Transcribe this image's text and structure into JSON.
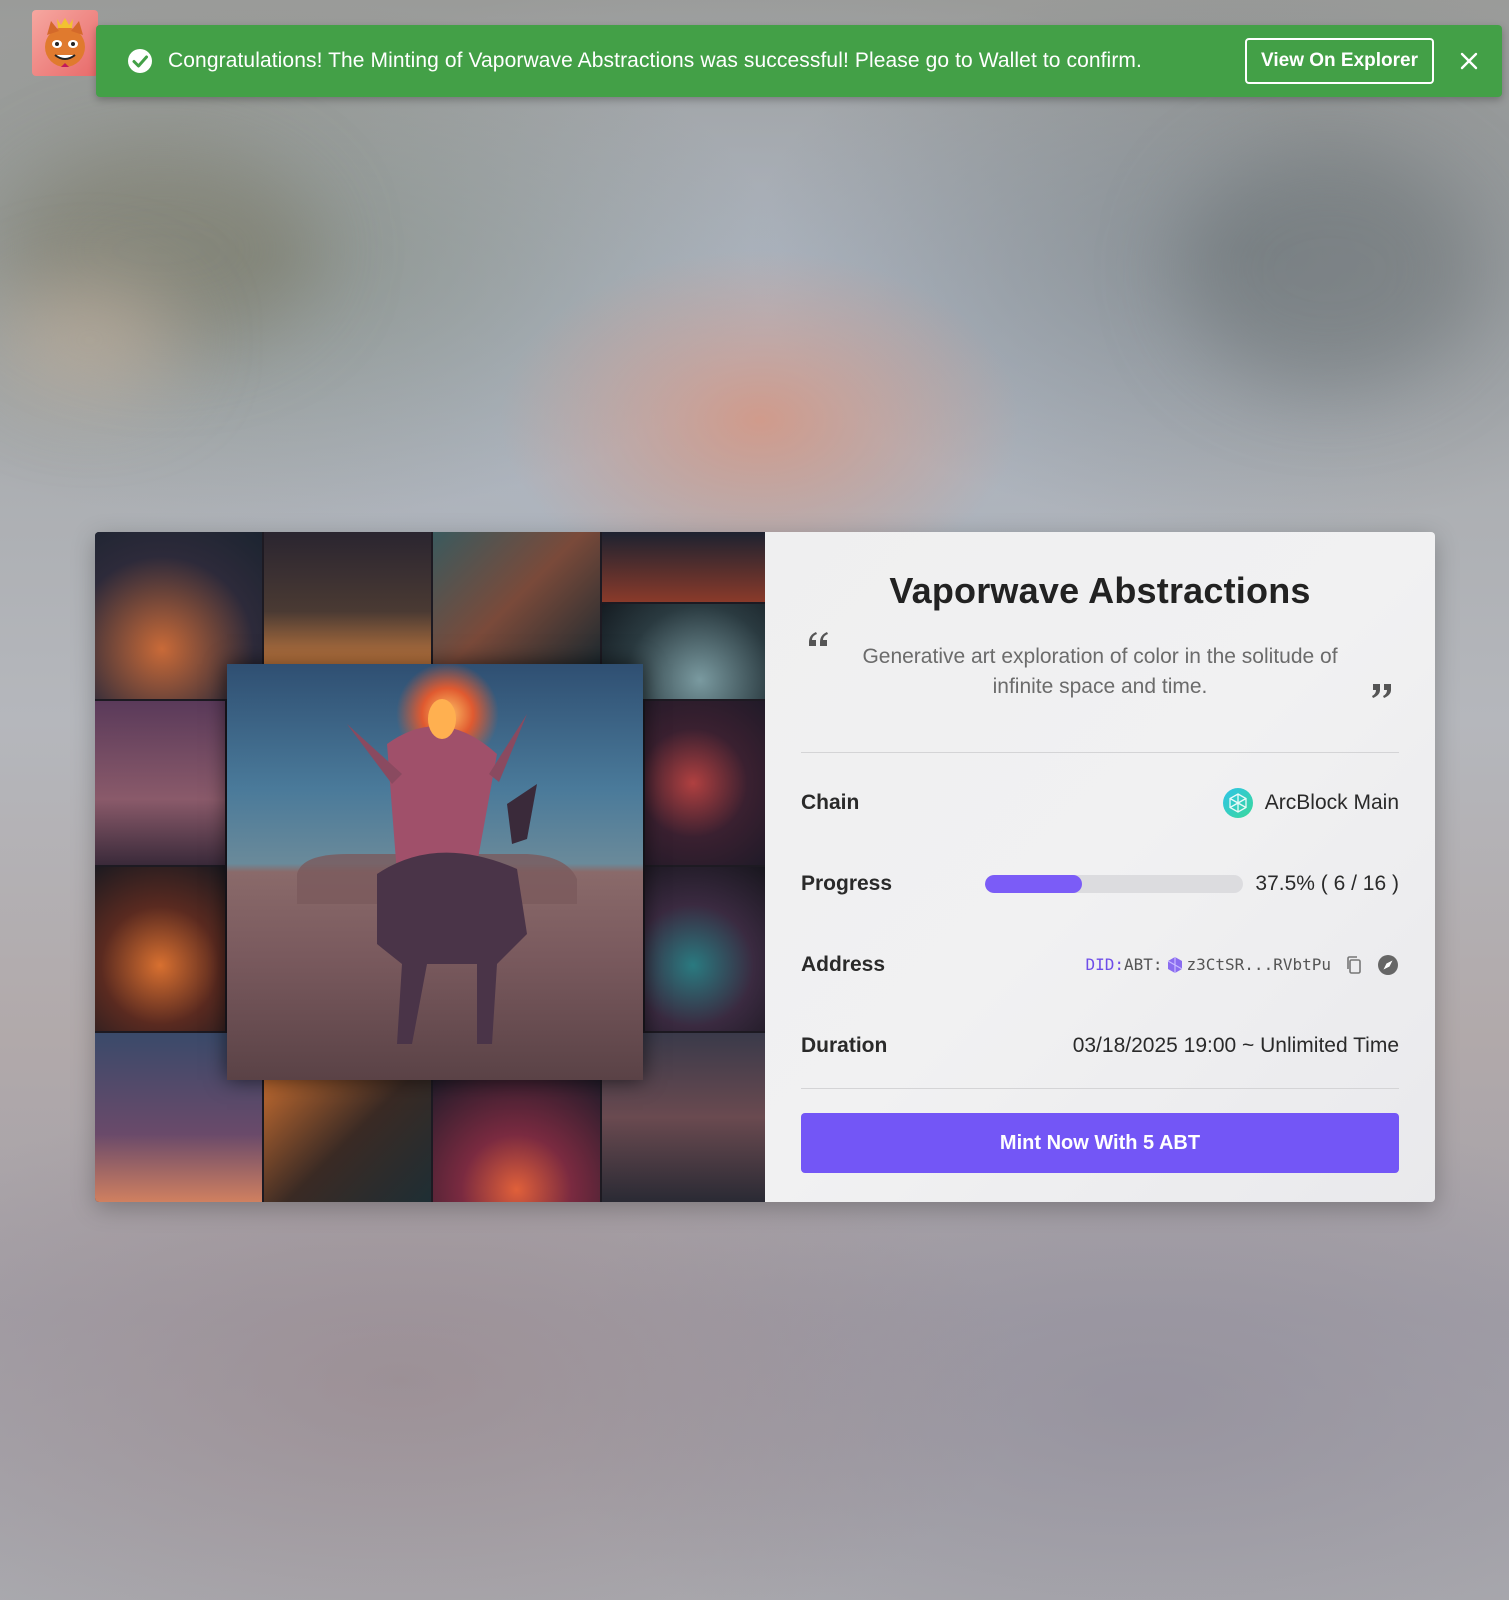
{
  "snackbar": {
    "message": "Congratulations! The Minting of Vaporwave Abstractions was successful! Please go to Wallet to confirm.",
    "action_label": "View On Explorer",
    "status_color": "#43a047",
    "icons": {
      "status": "check-circle-icon",
      "close": "close-icon"
    }
  },
  "collection": {
    "title": "Vaporwave Abstractions",
    "description": "Generative art exploration of color in the solitude of infinite space and time."
  },
  "details": {
    "chain": {
      "label": "Chain",
      "value": "ArcBlock Main",
      "icon": "arcblock-icon"
    },
    "progress": {
      "label": "Progress",
      "text": "37.5% ( 6 / 16 )",
      "fraction": 0.375,
      "minted": 6,
      "total": 16
    },
    "address": {
      "label": "Address",
      "prefix": "DID:",
      "type": "ABT:",
      "short": "z3CtSR...RVbtPu",
      "icons": [
        "copy-icon",
        "explorer-compass-icon"
      ]
    },
    "duration": {
      "label": "Duration",
      "value": "03/18/2025 19:00 ~ Unlimited Time"
    }
  },
  "mint_button": {
    "label": "Mint Now With 5 ABT",
    "color": "#7356f6"
  },
  "colors": {
    "accent": "#7b5cf7"
  }
}
